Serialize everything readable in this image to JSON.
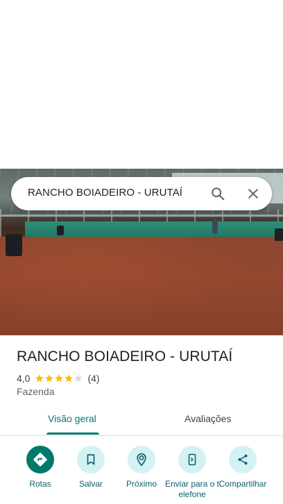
{
  "search": {
    "query": "RANCHO BOIADEIRO - URUTAÍ",
    "search_icon": "search-icon",
    "clear_icon": "close-icon"
  },
  "place": {
    "name": "RANCHO BOIADEIRO - URUTAÍ",
    "rating": "4,0",
    "rating_value": 4.0,
    "rating_max": 5,
    "review_count": "(4)",
    "category": "Fazenda"
  },
  "tabs": [
    {
      "label": "Visão geral",
      "active": true
    },
    {
      "label": "Avaliações",
      "active": false
    }
  ],
  "actions": [
    {
      "label": "Rotas",
      "icon": "directions-icon"
    },
    {
      "label": "Salvar",
      "icon": "bookmark-icon"
    },
    {
      "label": "Próximo",
      "icon": "nearby-icon"
    },
    {
      "label": "Enviar para o telefone",
      "icon": "send-to-phone-icon"
    },
    {
      "label": "Compartilhar",
      "icon": "share-icon"
    }
  ],
  "colors": {
    "accent": "#00796b",
    "action_bg": "#d4f1f4",
    "star": "#fbbc04",
    "star_empty": "#dadce0"
  }
}
